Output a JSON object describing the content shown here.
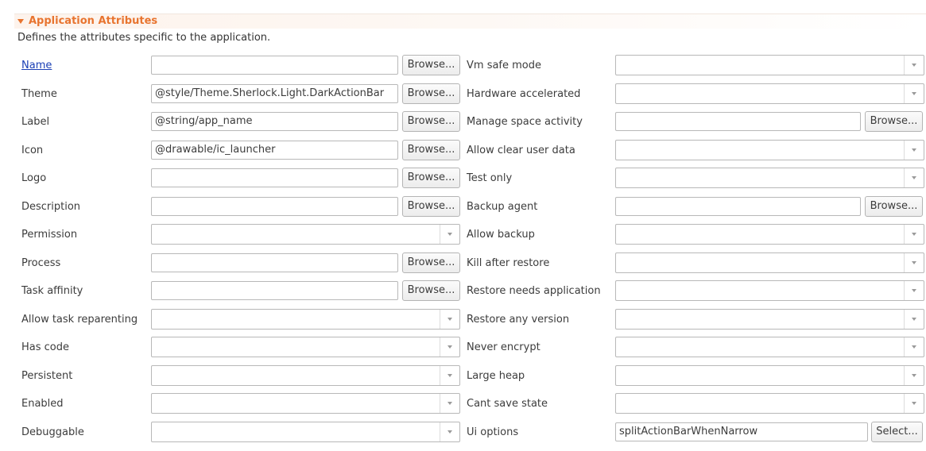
{
  "section": {
    "title": "Application Attributes",
    "description": "Defines the attributes specific to the application."
  },
  "browse_label": "Browse...",
  "select_label": "Select...",
  "left": [
    {
      "key": "name",
      "label": "Name",
      "kind": "text",
      "value": "",
      "link": true
    },
    {
      "key": "theme",
      "label": "Theme",
      "kind": "text",
      "value": "@style/Theme.Sherlock.Light.DarkActionBar"
    },
    {
      "key": "label",
      "label": "Label",
      "kind": "text",
      "value": "@string/app_name"
    },
    {
      "key": "icon",
      "label": "Icon",
      "kind": "text",
      "value": "@drawable/ic_launcher"
    },
    {
      "key": "logo",
      "label": "Logo",
      "kind": "text",
      "value": ""
    },
    {
      "key": "description",
      "label": "Description",
      "kind": "text",
      "value": ""
    },
    {
      "key": "permission",
      "label": "Permission",
      "kind": "combo",
      "value": ""
    },
    {
      "key": "process",
      "label": "Process",
      "kind": "text",
      "value": ""
    },
    {
      "key": "task-affinity",
      "label": "Task affinity",
      "kind": "text",
      "value": ""
    },
    {
      "key": "allow-task-reparenting",
      "label": "Allow task reparenting",
      "kind": "combo",
      "value": ""
    },
    {
      "key": "has-code",
      "label": "Has code",
      "kind": "combo",
      "value": ""
    },
    {
      "key": "persistent",
      "label": "Persistent",
      "kind": "combo",
      "value": ""
    },
    {
      "key": "enabled",
      "label": "Enabled",
      "kind": "combo",
      "value": ""
    },
    {
      "key": "debuggable",
      "label": "Debuggable",
      "kind": "combo",
      "value": ""
    }
  ],
  "right": [
    {
      "key": "vm-safe-mode",
      "label": "Vm safe mode",
      "kind": "combo",
      "value": ""
    },
    {
      "key": "hardware-accelerated",
      "label": "Hardware accelerated",
      "kind": "combo",
      "value": ""
    },
    {
      "key": "manage-space-activity",
      "label": "Manage space activity",
      "kind": "text",
      "value": ""
    },
    {
      "key": "allow-clear-user-data",
      "label": "Allow clear user data",
      "kind": "combo",
      "value": ""
    },
    {
      "key": "test-only",
      "label": "Test only",
      "kind": "combo",
      "value": ""
    },
    {
      "key": "backup-agent",
      "label": "Backup agent",
      "kind": "text",
      "value": ""
    },
    {
      "key": "allow-backup",
      "label": "Allow backup",
      "kind": "combo",
      "value": ""
    },
    {
      "key": "kill-after-restore",
      "label": "Kill after restore",
      "kind": "combo",
      "value": ""
    },
    {
      "key": "restore-needs-application",
      "label": "Restore needs application",
      "kind": "combo",
      "value": ""
    },
    {
      "key": "restore-any-version",
      "label": "Restore any version",
      "kind": "combo",
      "value": ""
    },
    {
      "key": "never-encrypt",
      "label": "Never encrypt",
      "kind": "combo",
      "value": ""
    },
    {
      "key": "large-heap",
      "label": "Large heap",
      "kind": "combo",
      "value": ""
    },
    {
      "key": "cant-save-state",
      "label": "Cant save state",
      "kind": "combo",
      "value": ""
    },
    {
      "key": "ui-options",
      "label": "Ui options",
      "kind": "select",
      "value": "splitActionBarWhenNarrow"
    }
  ]
}
